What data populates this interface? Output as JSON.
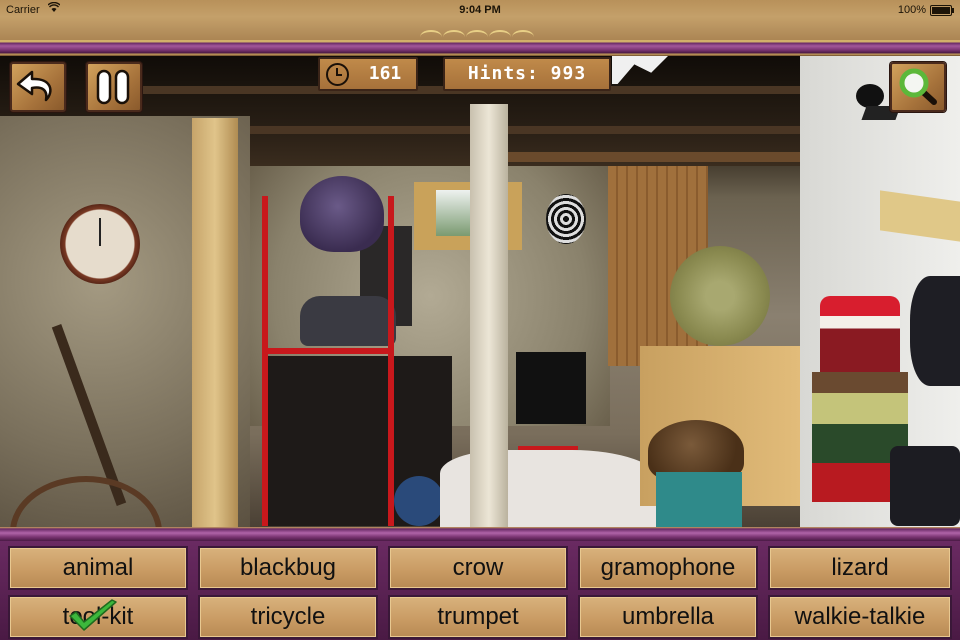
{
  "status_bar": {
    "carrier": "Carrier",
    "wifi_icon": "wifi-icon",
    "time": "9:04 PM",
    "battery_percent": "100%",
    "battery_icon": "battery-icon"
  },
  "hud": {
    "back_icon": "undo-arrow-icon",
    "pause_icon": "pause-icon",
    "timer_icon": "clock-icon",
    "timer_value": "161",
    "hints_label": "Hints: 993",
    "hint_icon": "magnifier-icon"
  },
  "scene": {
    "name": "basement hidden-object scene"
  },
  "word_list": [
    {
      "label": "animal",
      "found": false
    },
    {
      "label": "blackbug",
      "found": false
    },
    {
      "label": "crow",
      "found": false
    },
    {
      "label": "gramophone",
      "found": false
    },
    {
      "label": "lizard",
      "found": false
    },
    {
      "label": "tool-kit",
      "found": true
    },
    {
      "label": "tricycle",
      "found": false
    },
    {
      "label": "trumpet",
      "found": false
    },
    {
      "label": "umbrella",
      "found": false
    },
    {
      "label": "walkie-talkie",
      "found": false
    }
  ],
  "colors": {
    "frame_purple": "#7a3472",
    "parchment": "#c4a06a",
    "found_check": "#3cb83c"
  }
}
